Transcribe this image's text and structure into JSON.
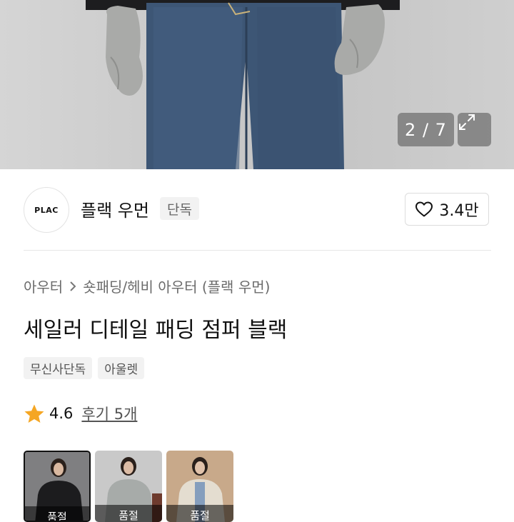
{
  "hero": {
    "page_counter": "2 / 7",
    "expand_icon": "expand-icon"
  },
  "brand": {
    "logo_text": "PLAC",
    "name": "플랙 우먼",
    "badge": "단독",
    "likes": "3.4만",
    "like_icon": "heart-outline-icon"
  },
  "breadcrumb": {
    "items": [
      "아우터",
      "숏패딩/헤비 아우터 (플랙 우먼)"
    ],
    "separator_icon": "chevron-right-icon"
  },
  "product": {
    "title": "세일러 디테일 패딩 점퍼 블랙",
    "tags": [
      "무신사단독",
      "아울렛"
    ]
  },
  "rating": {
    "star_icon": "star-icon",
    "star_color": "#f5a623",
    "score": "4.6",
    "review_link": "후기 5개"
  },
  "thumbnails": [
    {
      "label": "품절",
      "selected": true
    },
    {
      "label": "품절",
      "selected": false
    },
    {
      "label": "품절",
      "selected": false
    }
  ]
}
